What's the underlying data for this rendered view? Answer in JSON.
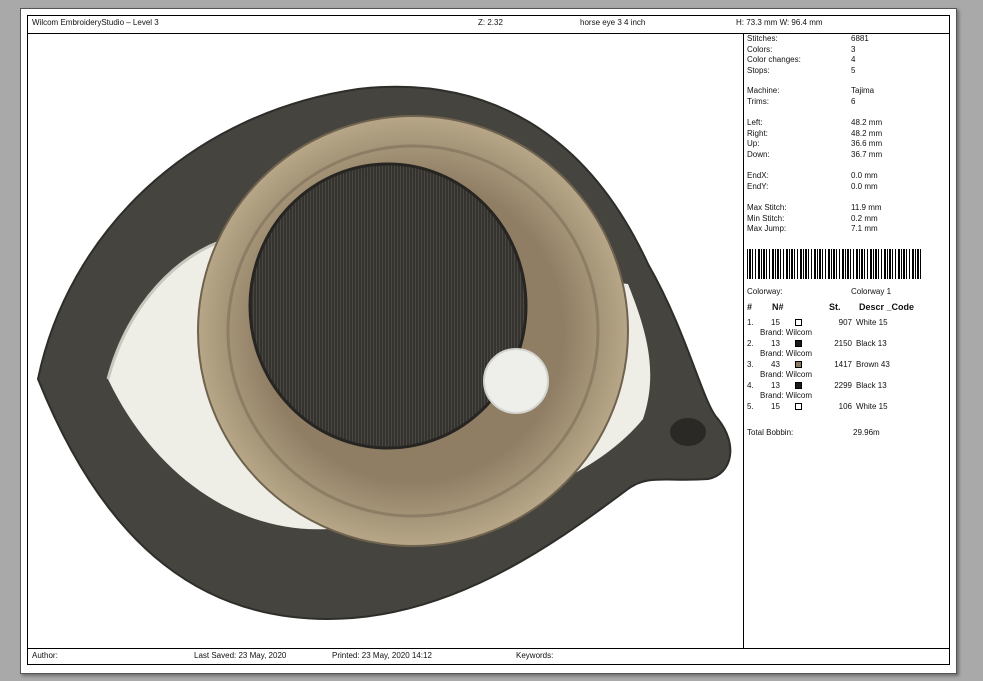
{
  "header": {
    "app_title": "Wilcom EmbroideryStudio – Level 3",
    "zoom": "Z: 2.32",
    "design_name": "horse eye 3 4 inch",
    "dimensions": "H: 73.3 mm   W: 96.4 mm"
  },
  "stats": [
    {
      "label": "Stitches:",
      "value": "6881"
    },
    {
      "label": "Colors:",
      "value": "3"
    },
    {
      "label": "Color changes:",
      "value": "4"
    },
    {
      "label": "Stops:",
      "value": "5"
    },
    {
      "label": "Machine:",
      "value": "Tajima"
    },
    {
      "label": "Trims:",
      "value": "6"
    },
    {
      "label": "Left:",
      "value": "48.2 mm"
    },
    {
      "label": "Right:",
      "value": "48.2 mm"
    },
    {
      "label": "Up:",
      "value": "36.6 mm"
    },
    {
      "label": "Down:",
      "value": "36.7 mm"
    },
    {
      "label": "EndX:",
      "value": "0.0 mm"
    },
    {
      "label": "EndY:",
      "value": "0.0 mm"
    },
    {
      "label": "Max Stitch:",
      "value": "11.9 mm"
    },
    {
      "label": "Min Stitch:",
      "value": "0.2 mm"
    },
    {
      "label": "Max Jump:",
      "value": "7.1 mm"
    }
  ],
  "colorway": {
    "label": "Colorway:",
    "value": "Colorway 1"
  },
  "table": {
    "headers": {
      "num": "#",
      "n": "N#",
      "st": "St.",
      "descr": "Descr _Code"
    },
    "rows": [
      {
        "idx": "1.",
        "n": "15",
        "swatch": "#ffffff",
        "st": "907",
        "descr": "White 15",
        "brand": "Brand: Wilcom"
      },
      {
        "idx": "2.",
        "n": "13",
        "swatch": "#1a1a1a",
        "st": "2150",
        "descr": "Black 13",
        "brand": "Brand: Wilcom"
      },
      {
        "idx": "3.",
        "n": "43",
        "swatch": "#8a7a62",
        "st": "1417",
        "descr": "Brown 43",
        "brand": "Brand: Wilcom"
      },
      {
        "idx": "4.",
        "n": "13",
        "swatch": "#1a1a1a",
        "st": "2299",
        "descr": "Black 13",
        "brand": "Brand: Wilcom"
      },
      {
        "idx": "5.",
        "n": "15",
        "swatch": "#ffffff",
        "st": "106",
        "descr": "White 15",
        "brand": ""
      }
    ]
  },
  "bobbin": {
    "label": "Total Bobbin:",
    "value": "29.96m"
  },
  "footer": {
    "author": "Author:",
    "last_saved": "Last Saved: 23 May, 2020",
    "printed": "Printed: 23 May, 2020 14:12",
    "keywords": "Keywords:"
  }
}
